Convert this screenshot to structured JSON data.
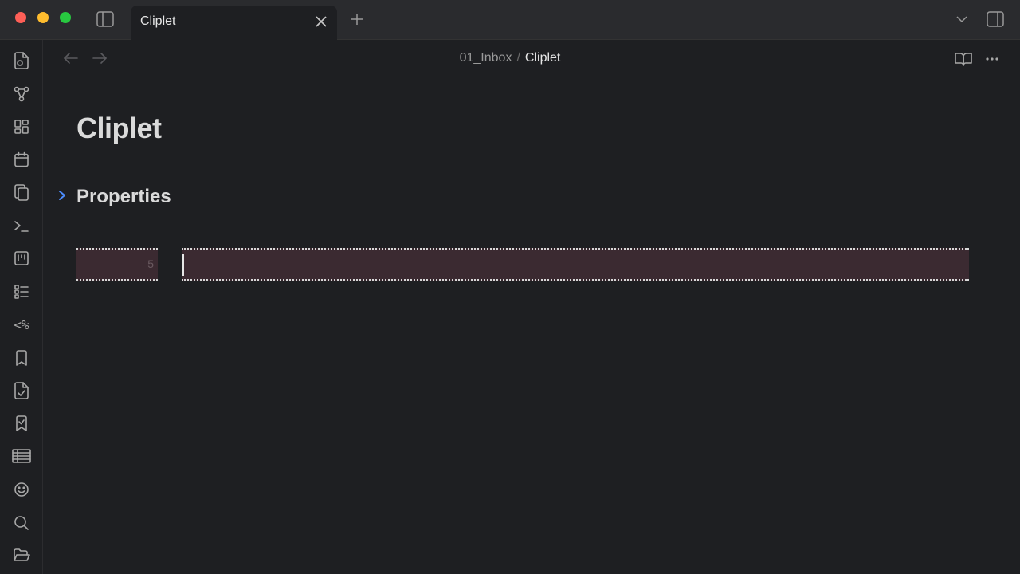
{
  "tab": {
    "title": "Cliplet"
  },
  "breadcrumb": {
    "parent": "01_Inbox",
    "separator": "/",
    "current": "Cliplet"
  },
  "note": {
    "title": "Cliplet",
    "properties_label": "Properties"
  },
  "editor": {
    "line_number": "5",
    "content": ""
  },
  "ribbon": {
    "items": [
      "file-plus-icon",
      "graph-icon",
      "dashboard-icon",
      "calendar-icon",
      "copy-icon",
      "terminal-icon",
      "kanban-icon",
      "checklist-icon",
      "templater-icon",
      "bookmark-icon",
      "file-check-icon",
      "bookmark-check-icon",
      "table-icon",
      "smiley-icon",
      "search-icon",
      "folder-open-icon"
    ],
    "templater_text": "<%"
  },
  "colors": {
    "accent": "#4c8dff",
    "highlight": "#3b2a31"
  }
}
